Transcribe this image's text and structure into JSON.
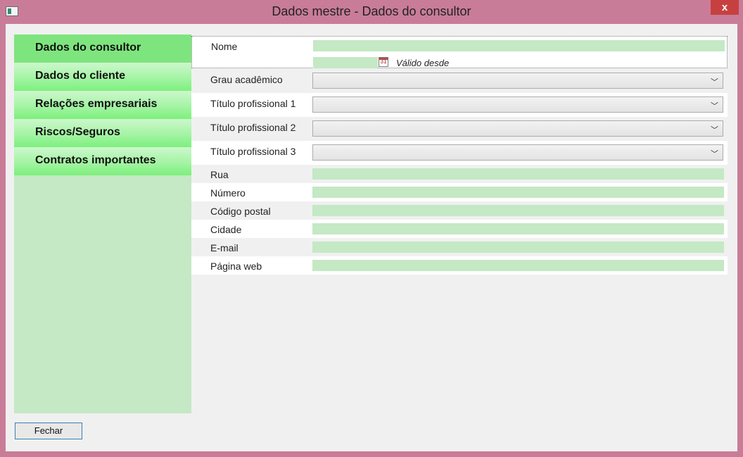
{
  "window": {
    "title": "Dados mestre - Dados do consultor",
    "close_label": "x"
  },
  "nav": {
    "items": [
      {
        "label": "Dados do consultor",
        "active": true
      },
      {
        "label": "Dados do cliente",
        "active": false
      },
      {
        "label": "Relações empresariais",
        "active": false
      },
      {
        "label": "Riscos/Seguros",
        "active": false
      },
      {
        "label": "Contratos importantes",
        "active": false
      }
    ]
  },
  "form": {
    "nome_label": "Nome",
    "nome_value": "",
    "valido_date": "",
    "valido_label": "Válido desde",
    "calendar_icon_text": "31",
    "grau_label": "Grau acadêmico",
    "titulo1_label": "Título profissional 1",
    "titulo2_label": "Título profissional 2",
    "titulo3_label": "Título profissional 3",
    "combo_arrow": "﹀",
    "rua_label": "Rua",
    "numero_label": "Número",
    "codigo_label": "Código postal",
    "cidade_label": "Cidade",
    "email_label": "E-mail",
    "pagina_label": "Página web"
  },
  "buttons": {
    "fechar_label": "Fechar"
  },
  "colors": {
    "title_bar": "#c97c98",
    "field_green": "#c4e9c4",
    "nav_active": "#7ee57e",
    "close_red": "#c74040"
  }
}
